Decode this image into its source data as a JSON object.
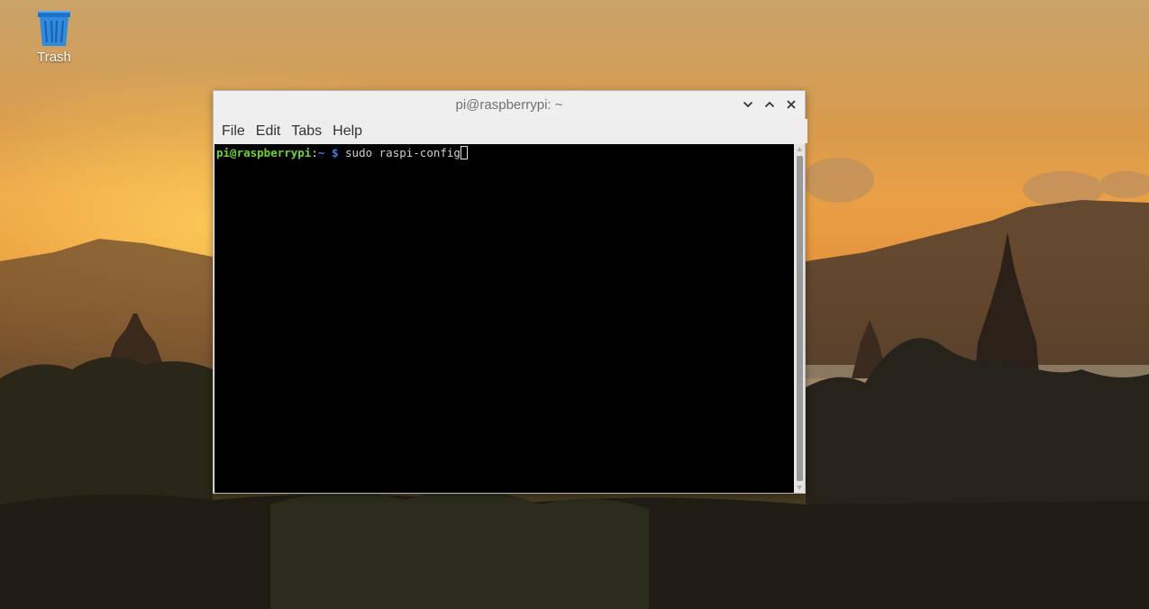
{
  "desktop": {
    "icons": [
      {
        "label": "Trash"
      }
    ]
  },
  "window": {
    "title": "pi@raspberrypi: ~",
    "controls": [
      "minimize-icon",
      "maximize-icon",
      "close-icon"
    ],
    "menu": [
      "File",
      "Edit",
      "Tabs",
      "Help"
    ]
  },
  "terminal": {
    "prompt_user_host": "pi@raspberrypi",
    "prompt_colon": ":",
    "prompt_path": "~",
    "prompt_symbol": "$",
    "command": "sudo raspi-config",
    "colors": {
      "background": "#000000",
      "user_host": "#6bd52f",
      "path": "#4f74e6",
      "command": "#d0d0d0"
    }
  }
}
